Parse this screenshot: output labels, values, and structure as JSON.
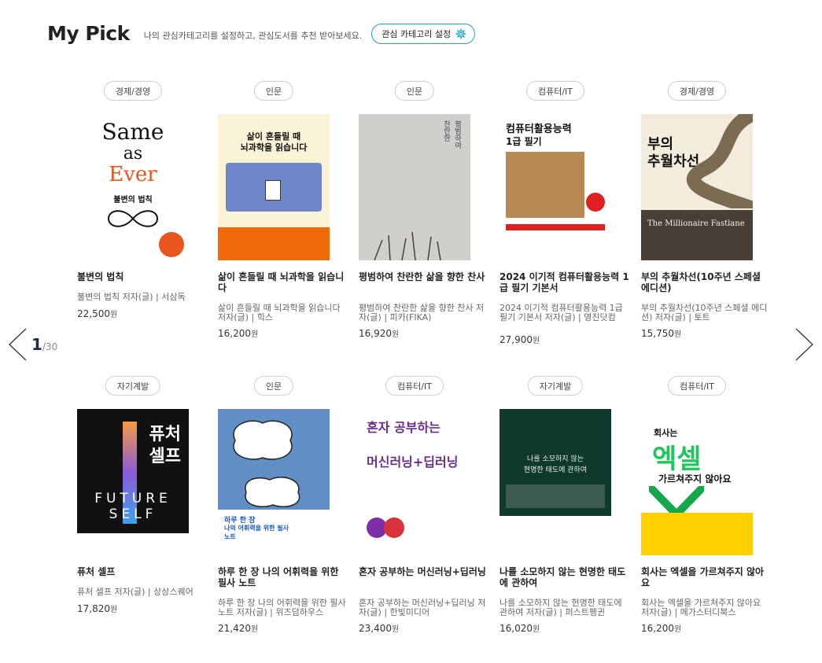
{
  "header": {
    "title": "My Pick",
    "subtitle": "나의 관심카테고리를 설정하고, 관심도서를 추천 받아보세요.",
    "setting_label": "관심 카테고리 설정"
  },
  "pager": {
    "current": "1",
    "total": "/30"
  },
  "books": [
    {
      "category": "경제/경영",
      "title": "불변의 법칙",
      "meta": "불변의 법칙 저자(글) | 서삼독",
      "price": "22,500",
      "won": "원",
      "cover": {
        "top": "Same",
        "mid": "as",
        "big": "Ever",
        "kr": "불변의 법칙"
      }
    },
    {
      "category": "인문",
      "title": "삶이 흔들릴 때 뇌과학을 읽습니다",
      "meta": "삶이 흔들릴 때 뇌과학을 읽습니다 저자(글) | 힉스",
      "price": "16,200",
      "won": "원",
      "cover": {
        "top": "삶이 흔들릴 때",
        "mid": "뇌과학을 읽습니다"
      }
    },
    {
      "category": "인문",
      "title": "평범하여 찬란한 삶을 향한 찬사",
      "meta": "평범하여 찬란한 삶을 향한 찬사 저자(글) | 피카(FIKA)",
      "price": "16,920",
      "won": "원",
      "cover": {
        "top": "평범하여",
        "mid": "찬란한"
      }
    },
    {
      "category": "컴퓨터/IT",
      "title": "2024 이기적 컴퓨터활용능력 1급 필기 기본서",
      "meta": "2024 이기적 컴퓨터활용능력 1급 필기 기본서 저자(글) | 영진닷컴",
      "price": "27,900",
      "won": "원",
      "cover": {
        "top": "컴퓨터활용능력",
        "mid": "1급 필기"
      }
    },
    {
      "category": "경제/경영",
      "title": "부의 추월차선(10주년 스페셜 에디션)",
      "meta": "부의 추월차선(10주년 스페셜 에디션) 저자(글) | 토트",
      "price": "15,750",
      "won": "원",
      "cover": {
        "top": "부의",
        "mid": "추월차선",
        "en": "The Millionaire Fastlane"
      }
    },
    {
      "category": "자기계발",
      "title": "퓨처 셀프",
      "meta": "퓨처 셀프 저자(글) | 상상스퀘어",
      "price": "17,820",
      "won": "원",
      "cover": {
        "top": "퓨처",
        "mid": "셀프",
        "en": "FUTURE",
        "en2": "SELF"
      }
    },
    {
      "category": "인문",
      "title": "하루 한 장 나의 어휘력을 위한 필사 노트",
      "meta": "하루 한 장 나의 어휘력을 위한 필사 노트 저자(글) | 위즈덤하우스",
      "price": "21,420",
      "won": "원",
      "cover": {
        "top": "하루 한 장",
        "mid": "나의 어휘력을 위한 필사 노트"
      }
    },
    {
      "category": "컴퓨터/IT",
      "title": "혼자 공부하는 머신러닝+딥러닝",
      "meta": "혼자 공부하는 머신러닝+딥러닝 저자(글) | 한빛미디어",
      "price": "23,400",
      "won": "원",
      "cover": {
        "top": "혼자 공부하는",
        "mid": "머신러닝+딥러닝"
      }
    },
    {
      "category": "자기계발",
      "title": "나를 소모하지 않는 현명한 태도에 관하여",
      "meta": "나를 소모하지 않는 현명한 태도에 관하여 저자(글) | 퍼스트펭귄",
      "price": "16,020",
      "won": "원",
      "cover": {
        "top": "나를 소모하지 않는",
        "mid": "현명한 태도에 관하여"
      }
    },
    {
      "category": "컴퓨터/IT",
      "title": "회사는 엑셀을 가르쳐주지 않아요",
      "meta": "회사는 엑셀을 가르쳐주지 않아요 저자(글) | 메가스터디북스",
      "price": "16,200",
      "won": "원",
      "cover": {
        "top": "회사는",
        "mid": "엑셀",
        "en": "가르쳐주지 않아요"
      }
    }
  ]
}
